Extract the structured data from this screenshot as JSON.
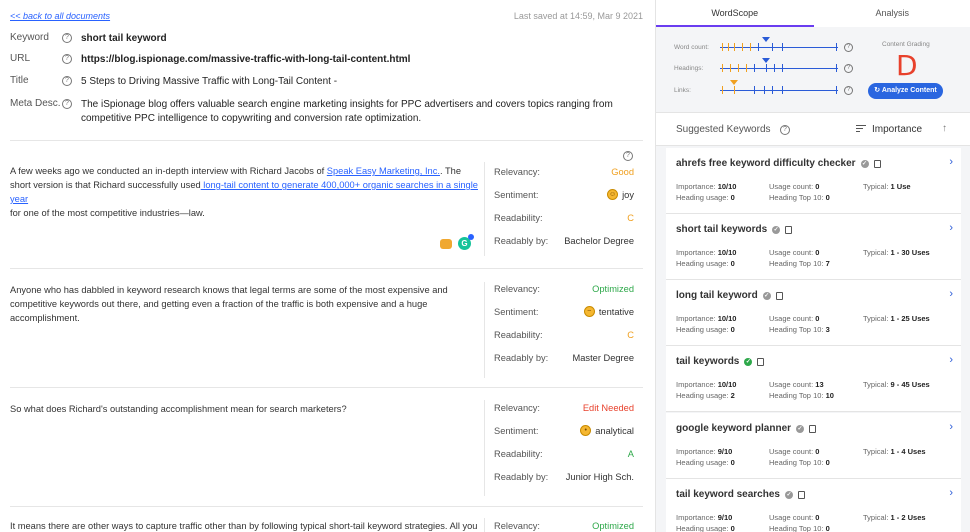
{
  "nav": {
    "back_label": "<< back to all documents",
    "last_saved": "Last saved at 14:59, Mar 9 2021"
  },
  "meta": {
    "keyword_label": "Keyword",
    "keyword_value": "short tail keyword",
    "url_label": "URL",
    "url_value": "https://blog.ispionage.com/massive-traffic-with-long-tail-content.html",
    "title_label": "Title",
    "title_value": "5 Steps to Driving Massive Traffic with Long-Tail Content -",
    "desc_label": "Meta Desc.",
    "desc_value": "The iSpionage blog offers valuable search engine marketing insights for PPC advertisers and covers topics ranging from competitive PPC intelligence to copywriting and conversion rate optimization."
  },
  "paragraphs": [
    {
      "t1": "A few weeks ago we conducted an in-depth interview with Richard Jacobs of ",
      "link1": "Speak Easy Marketing, Inc.",
      "t2": ". The short version is that Richard successfully used",
      "link2": " long-tail content to generate 400,000+ organic searches in a  single year",
      "t3": " for one of the most competitive industries—law.",
      "relevancy": "Good",
      "sentiment": "joy",
      "readability": "C",
      "readably_by": "Bachelor Degree",
      "relevancy_color": "#f0a020",
      "readability_color": "#f0a020"
    },
    {
      "text": "Anyone who has dabbled in keyword research knows that legal terms are some of the most expensive and competitive keywords out there, and getting even a fraction of the traffic is both expensive and a huge accomplishment.",
      "relevancy": "Optimized",
      "sentiment": "tentative",
      "readability": "C",
      "readably_by": "Master Degree",
      "relevancy_color": "#2ea84a",
      "readability_color": "#f0a020"
    },
    {
      "text": "So what does Richard's outstanding accomplishment mean for search marketers?",
      "relevancy": "Edit Needed",
      "sentiment": "analytical",
      "readability": "A",
      "readably_by": "Junior High Sch.",
      "relevancy_color": "#e8412c",
      "readability_color": "#2ea84a"
    },
    {
      "text": "It means there are other ways to capture traffic other than by following typical short-tail keyword strategies. All you",
      "relevancy": "Optimized",
      "relevancy_color": "#2ea84a"
    }
  ],
  "metric_labels": {
    "relevancy": "Relevancy:",
    "sentiment": "Sentiment:",
    "readability": "Readability:",
    "readably_by": "Readably by:"
  },
  "tabs": {
    "wordscope": "WordScope",
    "analysis": "Analysis"
  },
  "sliders": {
    "word_count": "Word count:",
    "headings": "Headings:",
    "links": "Links:"
  },
  "grading": {
    "label": "Content Grading",
    "grade": "D",
    "grade_color": "#e8412c",
    "analyze": "Analyze Content"
  },
  "keywords_panel": {
    "title": "Suggested Keywords",
    "sort_label": "Importance"
  },
  "stat_labels": {
    "importance": "Importance:",
    "heading_usage": "Heading usage:",
    "usage_count": "Usage count:",
    "heading_top": "Heading Top 10:",
    "typical": "Typical:"
  },
  "keywords": [
    {
      "name": "ahrefs free keyword difficulty checker",
      "importance": "10/10",
      "heading_usage": "0",
      "usage_count": "0",
      "heading_top": "0",
      "typical": "1 Use",
      "checked": false
    },
    {
      "name": "short tail keywords",
      "importance": "10/10",
      "heading_usage": "0",
      "usage_count": "0",
      "heading_top": "7",
      "typical": "1 - 30 Uses",
      "checked": false
    },
    {
      "name": "long tail keyword",
      "importance": "10/10",
      "heading_usage": "0",
      "usage_count": "0",
      "heading_top": "3",
      "typical": "1 - 25 Uses",
      "checked": false
    },
    {
      "name": "tail keywords",
      "importance": "10/10",
      "heading_usage": "2",
      "usage_count": "13",
      "heading_top": "10",
      "typical": "9 - 45 Uses",
      "checked": true
    },
    {
      "name": "google keyword planner",
      "importance": "9/10",
      "heading_usage": "0",
      "usage_count": "0",
      "heading_top": "0",
      "typical": "1 - 4 Uses",
      "checked": false
    },
    {
      "name": "tail keyword searches",
      "importance": "9/10",
      "heading_usage": "0",
      "usage_count": "0",
      "heading_top": "0",
      "typical": "1 - 2 Uses",
      "checked": false
    }
  ]
}
